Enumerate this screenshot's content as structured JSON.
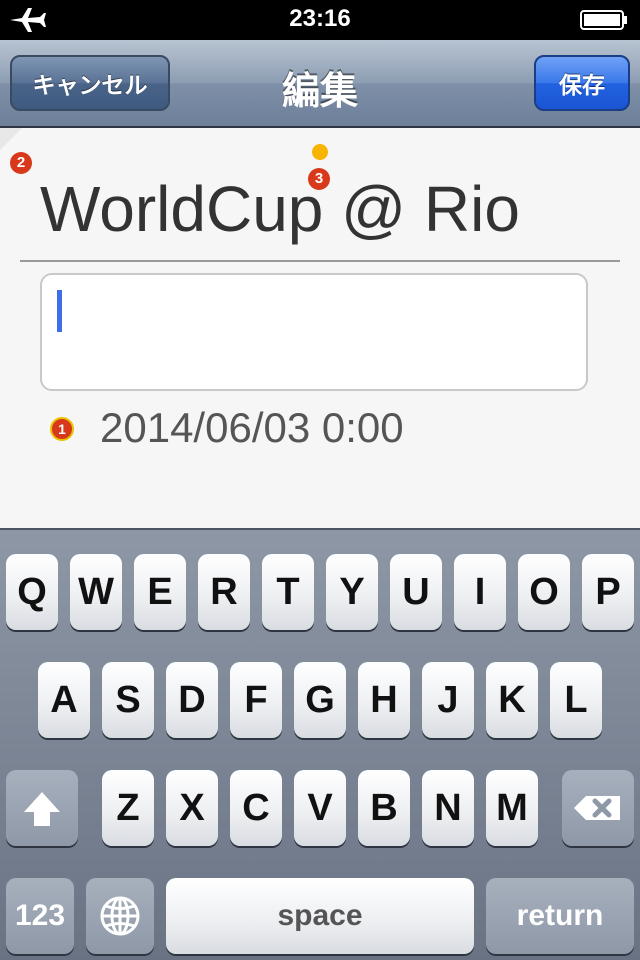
{
  "status_bar": {
    "time": "23:16",
    "icons": [
      "airplane-icon",
      "battery-icon"
    ]
  },
  "nav_bar": {
    "title": "編集",
    "cancel_label": "キャンセル",
    "save_label": "保存",
    "colors": {
      "bar": "#7f90a8",
      "save_button": "#2262e0"
    }
  },
  "editor": {
    "title_value": "WorldCup @ Rio",
    "notes_value": "",
    "date_value": "2014/06/03 0:00",
    "badges": {
      "date_marker": "1",
      "corner_marker": "2",
      "title_marker": "3"
    },
    "colors": {
      "badge": "#d8391a",
      "yellow_dot": "#f7b500",
      "caret": "#3f6fe8"
    }
  },
  "keyboard": {
    "row1": [
      "Q",
      "W",
      "E",
      "R",
      "T",
      "Y",
      "U",
      "I",
      "O",
      "P"
    ],
    "row2": [
      "A",
      "S",
      "D",
      "F",
      "G",
      "H",
      "J",
      "K",
      "L"
    ],
    "row3": [
      "Z",
      "X",
      "C",
      "V",
      "B",
      "N",
      "M"
    ],
    "mode_key": "123",
    "space_label": "space",
    "return_label": "return",
    "icons": [
      "shift-icon",
      "delete-icon",
      "globe-icon"
    ]
  }
}
